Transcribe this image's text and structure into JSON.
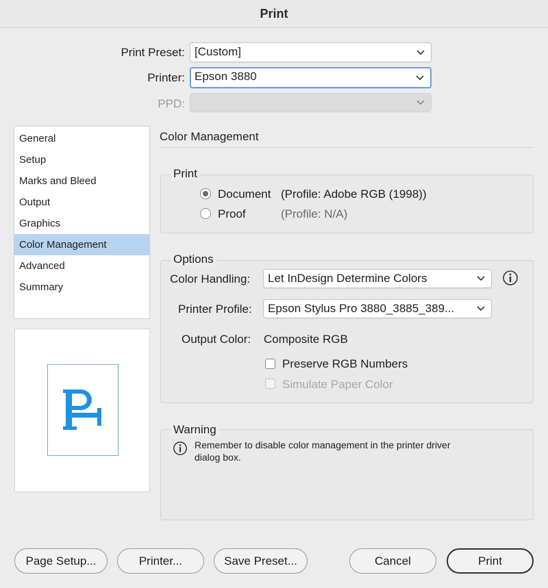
{
  "window": {
    "title": "Print"
  },
  "header": {
    "print_preset_label": "Print Preset:",
    "print_preset_value": "[Custom]",
    "printer_label": "Printer:",
    "printer_value": "Epson 3880",
    "ppd_label": "PPD:",
    "ppd_value": ""
  },
  "sidebar": {
    "items": [
      {
        "label": "General"
      },
      {
        "label": "Setup"
      },
      {
        "label": "Marks and Bleed"
      },
      {
        "label": "Output"
      },
      {
        "label": "Graphics"
      },
      {
        "label": "Color Management",
        "selected": true
      },
      {
        "label": "Advanced"
      },
      {
        "label": "Summary"
      }
    ]
  },
  "preview": {
    "glyph": "P",
    "glyph_color": "#1e90e6"
  },
  "main": {
    "section_title": "Color Management",
    "print_group": {
      "legend": "Print",
      "document_label": "Document",
      "document_profile": "(Profile: Adobe RGB (1998))",
      "proof_label": "Proof",
      "proof_profile": "(Profile: N/A)",
      "selected": "Document"
    },
    "options_group": {
      "legend": "Options",
      "color_handling_label": "Color Handling:",
      "color_handling_value": "Let InDesign Determine Colors",
      "printer_profile_label": "Printer Profile:",
      "printer_profile_value": "Epson Stylus Pro 3880_3885_389...",
      "output_color_label": "Output Color:",
      "output_color_value": "Composite RGB",
      "preserve_rgb_label": "Preserve RGB Numbers",
      "preserve_rgb_checked": false,
      "simulate_paper_label": "Simulate Paper Color",
      "simulate_paper_checked": false,
      "simulate_paper_enabled": false
    },
    "warning_group": {
      "legend": "Warning",
      "message_line1": "Remember to disable color management in the printer driver",
      "message_line2": "dialog box."
    }
  },
  "footer": {
    "page_setup_label": "Page Setup...",
    "printer_label": "Printer...",
    "save_preset_label": "Save Preset...",
    "cancel_label": "Cancel",
    "print_label": "Print"
  },
  "icons": {
    "chevron": "chevron-down-icon",
    "info": "info-icon",
    "accent_color": "#b6d3f0"
  }
}
